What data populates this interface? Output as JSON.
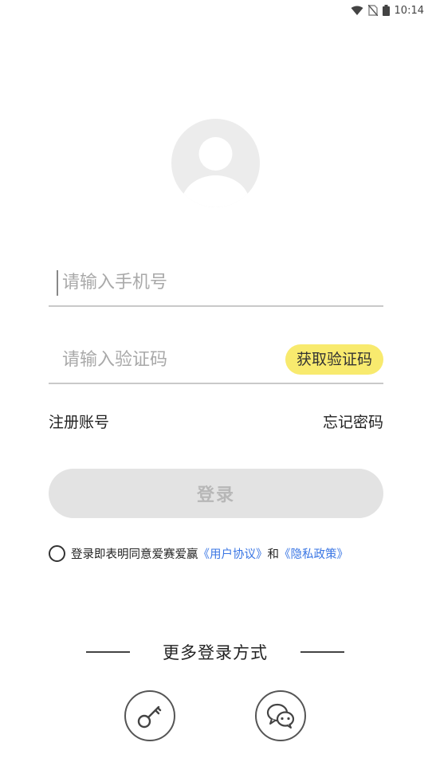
{
  "status_bar": {
    "time": "10:14",
    "icons": [
      "wifi-icon",
      "no-sim-icon",
      "battery-icon"
    ]
  },
  "login": {
    "phone_placeholder": "请输入手机号",
    "code_placeholder": "请输入验证码",
    "get_code_label": "获取验证码",
    "register_label": "注册账号",
    "forgot_label": "忘记密码",
    "login_label": "登录"
  },
  "agreement": {
    "prefix": "登录即表明同意爱赛爱赢",
    "user_agreement": "《用户协议》",
    "and": "和",
    "privacy_policy": "《隐私政策》"
  },
  "more_login": {
    "title": "更多登录方式",
    "options": [
      "key-icon",
      "wechat-icon"
    ]
  },
  "colors": {
    "accent_yellow": "#f8ea6e",
    "link_blue": "#3a76e4",
    "disabled_button": "#e3e3e3"
  }
}
